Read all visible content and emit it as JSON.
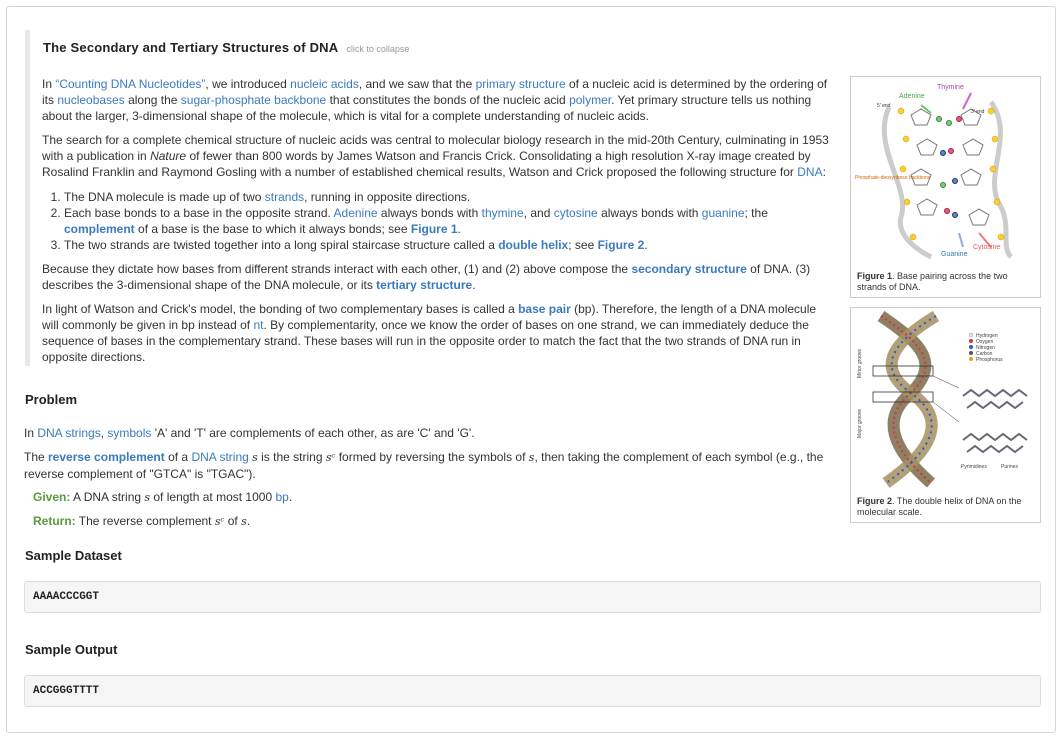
{
  "section": {
    "title": "The Secondary and Tertiary Structures of DNA",
    "collapse_hint": "click to collapse"
  },
  "p1": {
    "t0": "In ",
    "l_counting": "“Counting DNA Nucleotides”",
    "t1": ", we introduced ",
    "l_nucleic": "nucleic acids",
    "t2": ", and we saw that the ",
    "l_primary": "primary structure",
    "t3": " of a nucleic acid is determined by the ordering of its ",
    "l_nucleobases": "nucleobases",
    "t4": " along the ",
    "l_backbone": "sugar-phosphate backbone",
    "t5": " that constitutes the bonds of the nucleic acid ",
    "l_polymer": "polymer",
    "t6": ". Yet primary structure tells us nothing about the larger, 3-dimensional shape of the molecule, which is vital for a complete understanding of nucleic acids."
  },
  "p2": {
    "t0": "The search for a complete chemical structure of nucleic acids was central to molecular biology research in the mid-20th Century, culminating in 1953 with a publication in ",
    "nature": "Nature",
    "t1": " of fewer than 800 words by James Watson and Francis Crick. Consolidating a high resolution X-ray image created by Rosalind Franklin and Raymond Gosling with a number of established chemical results, Watson and Crick proposed the following structure for ",
    "l_dna": "DNA",
    "t2": ":"
  },
  "list": {
    "i1_t0": "The DNA molecule is made up of two ",
    "i1_l": "strands",
    "i1_t1": ", running in opposite directions.",
    "i2_t0": "Each base bonds to a base in the opposite strand. ",
    "i2_adenine": "Adenine",
    "i2_t1": " always bonds with ",
    "i2_thymine": "thymine",
    "i2_t2": ", and ",
    "i2_cytosine": "cytosine",
    "i2_t3": " always bonds with ",
    "i2_guanine": "guanine",
    "i2_t4": "; the ",
    "i2_complement": "complement",
    "i2_t5": " of a base is the base to which it always bonds; see ",
    "i2_fig": "Figure 1",
    "i2_t6": ".",
    "i3_t0": "The two strands are twisted together into a long spiral staircase structure called a ",
    "i3_helix": "double helix",
    "i3_t1": "; see ",
    "i3_fig": "Figure 2",
    "i3_t2": "."
  },
  "p3": {
    "t0": "Because they dictate how bases from different strands interact with each other, (1) and (2) above compose the ",
    "l_secondary": "secondary structure",
    "t1": " of DNA. (3) describes the 3-dimensional shape of the DNA molecule, or its ",
    "l_tertiary": "tertiary structure",
    "t2": "."
  },
  "p4": {
    "t0": "In light of Watson and Crick's model, the bonding of two complementary bases is called a ",
    "l_bp": "base pair",
    "t1": " (bp). Therefore, the length of a DNA molecule will commonly be given in bp instead of ",
    "l_nt": "nt",
    "t2": ". By complementarity, once we know the order of bases on one strand, we can immediately deduce the sequence of bases in the complementary strand. These bases will run in the opposite order to match the fact that the two strands of DNA run in opposite directions."
  },
  "problem": {
    "heading": "Problem",
    "p1_t0": "In ",
    "p1_l1": "DNA strings",
    "p1_t1": ", ",
    "p1_l2": "symbols",
    "p1_t2": " 'A' and 'T' are complements of each other, as are 'C' and 'G'.",
    "p2_t0": "The ",
    "p2_l1": "reverse complement",
    "p2_t1": " of a ",
    "p2_l2": "DNA string",
    "p2_t2": " ",
    "p2_s": "s",
    "p2_t3": " is the string ",
    "p2_sc": "sᶜ",
    "p2_t4": " formed by reversing the symbols of ",
    "p2_s2": "s",
    "p2_t5": ", then taking the complement of each symbol (e.g., the reverse complement of \"GTCA\" is \"TGAC\").",
    "given_label": "Given:",
    "given_t0": " A DNA string ",
    "given_s": "s",
    "given_t1": " of length at most 1000 ",
    "given_bp": "bp",
    "given_t2": ".",
    "return_label": "Return:",
    "return_t0": " The reverse complement ",
    "return_sc": "sᶜ",
    "return_t1": " of ",
    "return_s": "s",
    "return_t2": "."
  },
  "sample_dataset": {
    "heading": "Sample Dataset",
    "value": "AAAACCCGGT"
  },
  "sample_output": {
    "heading": "Sample Output",
    "value": "ACCGGGTTTT"
  },
  "figure1": {
    "label": "Figure 1",
    "caption": ". Base pairing across the two strands of DNA.",
    "labels": {
      "thymine": "Thymine",
      "adenine": "Adenine",
      "five_end": "5' end",
      "three_end": "3' end",
      "backbone": "Phosphate-deoxyribose backbone",
      "cytosine": "Cytosine",
      "guanine": "Guanine"
    }
  },
  "figure2": {
    "label": "Figure 2",
    "caption": ". The double helix of DNA on the molecular scale.",
    "legend": [
      "Hydrogen",
      "Oxygen",
      "Nitrogen",
      "Carbon",
      "Phosphorus"
    ],
    "legend_colors": [
      "#e8e8e8",
      "#d33",
      "#35c",
      "#555",
      "#e8a020"
    ],
    "minor_groove": "Minor groove",
    "major_groove": "Major groove",
    "pyrimidines": "Pyrimidines",
    "purines": "Purines"
  }
}
